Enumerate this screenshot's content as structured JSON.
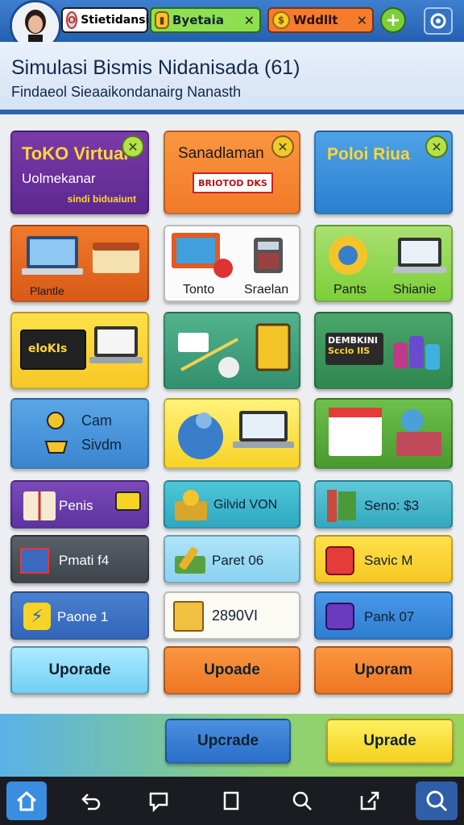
{
  "header": {
    "pill1_text": "Stietidansi",
    "pill2_text": "Byetaia",
    "pill3_text": "Wddllt"
  },
  "banner": {
    "title": "Simulasi Bismis Nidanisada (61)",
    "subtitle": "Findaeol Sieaaikondanairg Nanasth"
  },
  "tiles": {
    "r1c1_title": "ToKO Virtual",
    "r1c1_line2": "Uolmekanar",
    "r1c1_line3": "sindi biduaiunt",
    "r1c2_title": "Sanadlaman",
    "r1c2_sub": "BRIOTOD DKS",
    "r1c3_title": "Poloi Riua",
    "r2c1_label": "Plantle",
    "r2c2_label1": "Tonto",
    "r2c2_label2": "Sraelan",
    "r2c3_label1": "Pants",
    "r2c3_label2": "Shianie",
    "r3c1_label": "eloKIs",
    "r3c3_label1": "DEMBKINI",
    "r3c3_label2": "Sccio IIS",
    "r4c1_label1": "Cam",
    "r4c1_label2": "Sivdm",
    "r5c1_label": "Penis",
    "r5c2_label": "Gilvid VON",
    "r5c3_label": "Seno: $3",
    "r6c1_label": "Pmati f4",
    "r6c2_label": "Paret 06",
    "r6c3_label": "Savic M",
    "r7c1_label": "Paone 1",
    "r7c2_label": "2890VI",
    "r7c3_label": "Pank 07"
  },
  "upgrades": {
    "u1": "Uporade",
    "u2": "Upoade",
    "u3": "Uporam",
    "u4": "Upcrade",
    "u5": "Uprade"
  },
  "colors": {
    "header_blue": "#2f6fc4",
    "green_accent": "#9bd35e",
    "orange": "#f07a2a",
    "yellow": "#f7d325",
    "purple": "#6a3ca0"
  },
  "icons": [
    "avatar",
    "coin-icon",
    "gem-icon",
    "plus-icon",
    "settings-icon",
    "home-icon",
    "back-icon",
    "chat-icon",
    "square-icon",
    "search-icon",
    "share-icon",
    "search-main-icon"
  ]
}
